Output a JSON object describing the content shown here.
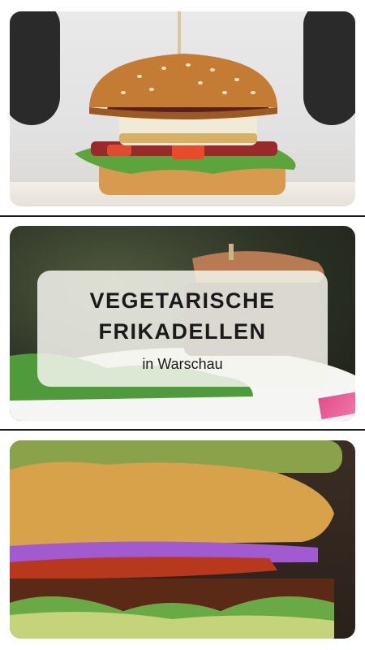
{
  "overlay": {
    "title_line1": "VEGETARISCHE",
    "title_line2": "FRIKADELLEN",
    "subtitle": "in Warschau"
  },
  "images": [
    {
      "name": "veggie-burger-with-halloumi-photo"
    },
    {
      "name": "burger-on-plate-with-salad-photo"
    },
    {
      "name": "breaded-patty-burger-with-guacamole-photo"
    }
  ],
  "colors": {
    "overlay_background": "#f5f5ee",
    "text": "#1a1a1a",
    "divider": "#1b1b1b"
  }
}
